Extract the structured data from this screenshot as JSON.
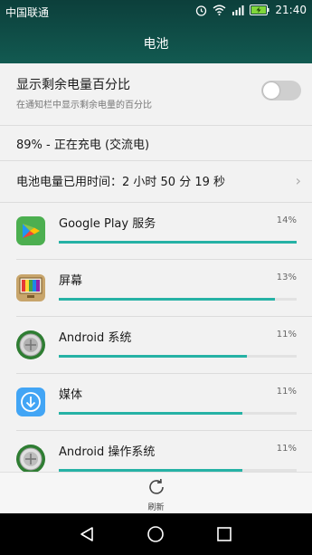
{
  "status_bar": {
    "carrier": "中国联通",
    "time": "21:40"
  },
  "header": {
    "title": "电池"
  },
  "settings": {
    "percent_toggle": {
      "title": "显示剩余电量百分比",
      "subtitle": "在通知栏中显示剩余电量的百分比",
      "enabled": false
    },
    "charge_status": "89% - 正在充电 (交流电)",
    "usage_time": "电池电量已用时间：2 小时 50 分 19 秒"
  },
  "apps": [
    {
      "name": "Google Play 服务",
      "percent_label": "14%",
      "bar_fraction": 1.0,
      "icon": "google-play-services-icon"
    },
    {
      "name": "屏幕",
      "percent_label": "13%",
      "bar_fraction": 0.91,
      "icon": "screen-icon"
    },
    {
      "name": "Android 系统",
      "percent_label": "11%",
      "bar_fraction": 0.79,
      "icon": "android-system-icon"
    },
    {
      "name": "媒体",
      "percent_label": "11%",
      "bar_fraction": 0.77,
      "icon": "media-icon"
    },
    {
      "name": "Android 操作系统",
      "percent_label": "11%",
      "bar_fraction": 0.77,
      "icon": "android-os-icon"
    }
  ],
  "bottom_action": {
    "label": "刷新",
    "icon": "refresh-icon"
  },
  "colors": {
    "accent": "#26b2a5",
    "header_bg": "#0f4d47"
  }
}
